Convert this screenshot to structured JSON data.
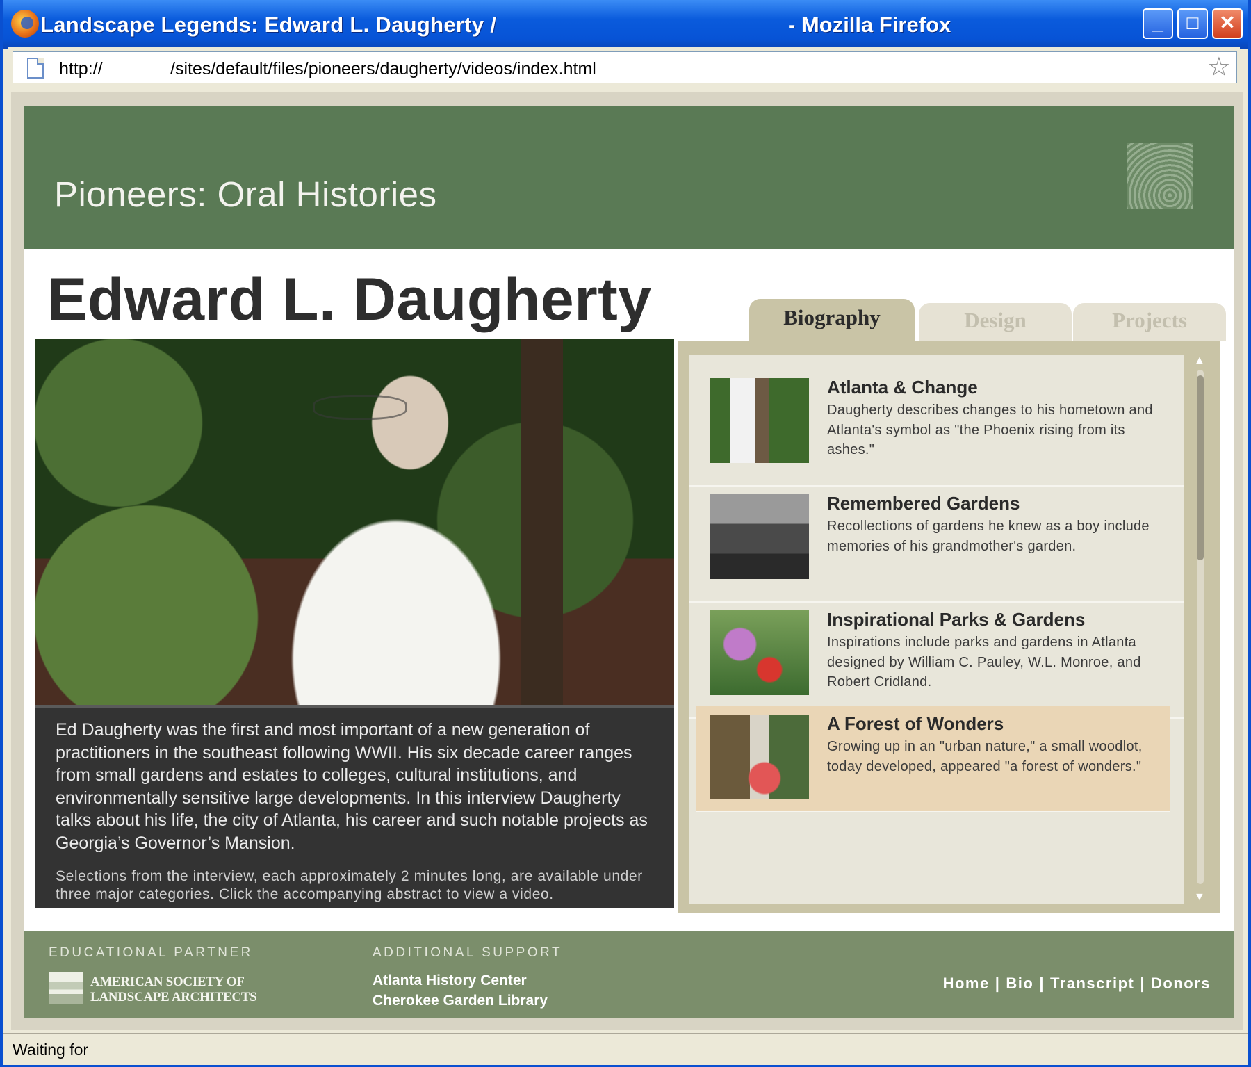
{
  "window": {
    "title": "Landscape Legends: Edward L. Daugherty /",
    "title_suffix": "- Mozilla Firefox",
    "minimize": "_",
    "maximize": "□",
    "close": "✕"
  },
  "address": {
    "scheme": "http://",
    "path": "/sites/default/files/pioneers/daugherty/videos/index.html",
    "bookmark_icon": "☆"
  },
  "header": {
    "site_title": "Pioneers: Oral Histories",
    "person_name": "Edward L. Daugherty"
  },
  "tabs": [
    {
      "label": "Biography",
      "active": true
    },
    {
      "label": "Design",
      "active": false
    },
    {
      "label": "Projects",
      "active": false
    }
  ],
  "bio": {
    "main": "Ed Daugherty was the first and most important of a new generation of practitioners in the southeast following WWII. His six decade career ranges from small gardens and estates to colleges, cultural institutions, and environmentally sensitive large developments.  In this interview Daugherty talks about his life, the city of Atlanta, his career and such notable projects as Georgia’s Governor’s Mansion.",
    "sub": "Selections from the interview, each approximately 2 minutes long, are available under three major categories. Click the accompanying abstract to view a video."
  },
  "videos": [
    {
      "title": "Atlanta & Change",
      "desc": "Daugherty describes changes to his hometown and Atlanta's symbol as \"the Phoenix rising from its ashes.\""
    },
    {
      "title": "Remembered Gardens",
      "desc": "Recollections of gardens he knew as a boy include memories of his grandmother's garden."
    },
    {
      "title": "Inspirational Parks & Gardens",
      "desc": "Inspirations include parks and gardens in Atlanta designed by William C. Pauley, W.L. Monroe, and Robert Cridland."
    },
    {
      "title": "A Forest of Wonders",
      "desc": "Growing up in an \"urban nature,\" a small woodlot, today developed, appeared \"a forest of wonders.\""
    }
  ],
  "scroll": {
    "up": "▲",
    "down": "▼"
  },
  "footer": {
    "partner_label": "EDUCATIONAL PARTNER",
    "asla_line1": "AMERICAN SOCIETY OF",
    "asla_line2": "LANDSCAPE ARCHITECTS",
    "support_label": "ADDITIONAL SUPPORT",
    "support_line1": "Atlanta History Center",
    "support_line2": "Cherokee Garden Library",
    "links": {
      "home": "Home",
      "bio": "Bio",
      "transcript": "Transcript",
      "donors": "Donors"
    },
    "separator": "|"
  },
  "status": {
    "text": "Waiting for"
  }
}
